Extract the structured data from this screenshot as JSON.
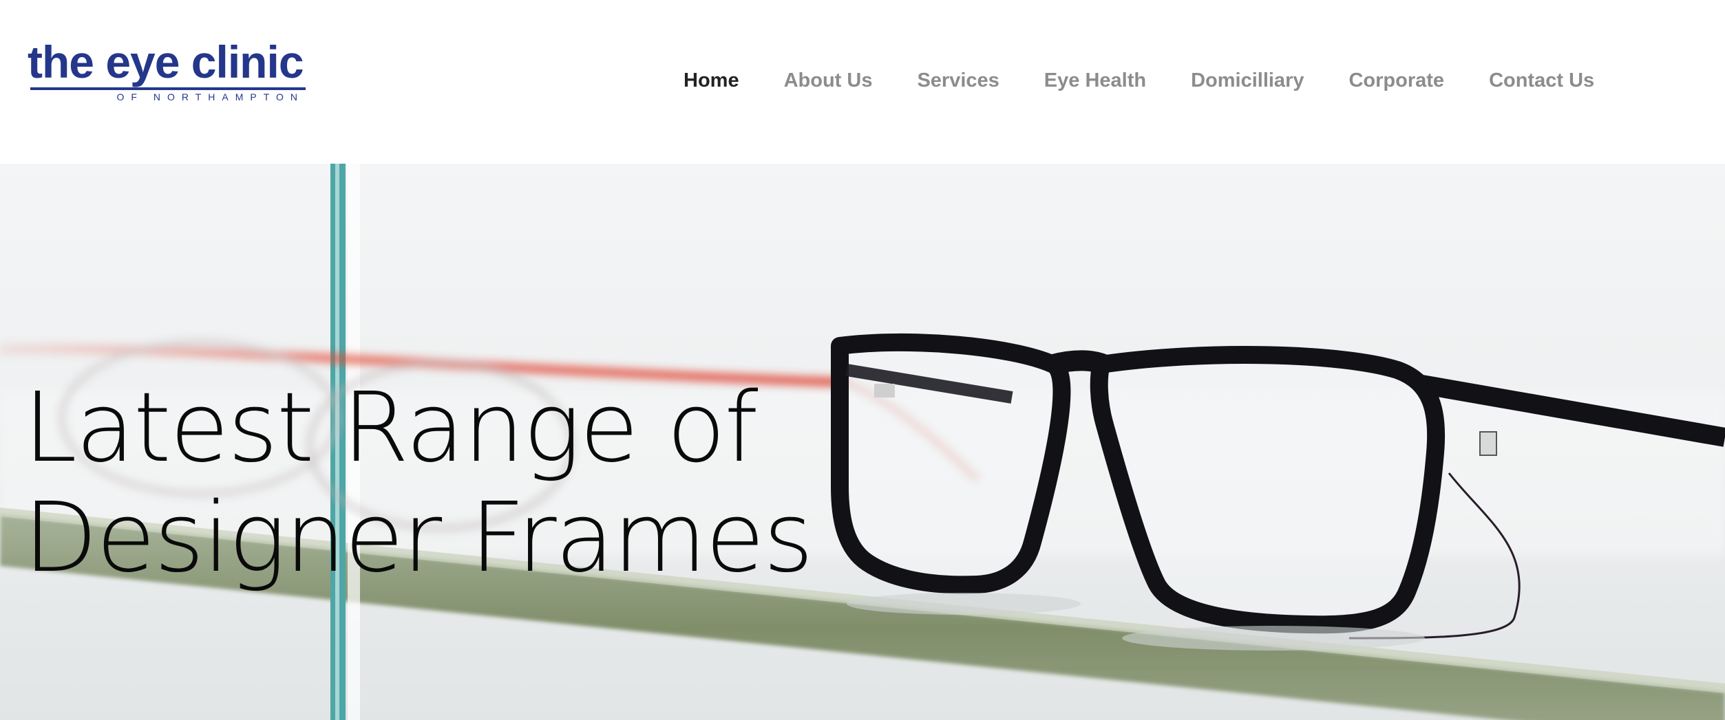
{
  "logo": {
    "title": "the eye clinic",
    "subtitle": "OF NORTHAMPTON",
    "color": "#24378a"
  },
  "nav": {
    "items": [
      {
        "label": "Home",
        "active": true
      },
      {
        "label": "About Us",
        "active": false
      },
      {
        "label": "Services",
        "active": false
      },
      {
        "label": "Eye Health",
        "active": false
      },
      {
        "label": "Domicilliary",
        "active": false
      },
      {
        "label": "Corporate",
        "active": false
      },
      {
        "label": "Contact Us",
        "active": false
      }
    ],
    "active_color": "#222222",
    "inactive_color": "#8c8c8c"
  },
  "hero": {
    "title": "Latest Range of Designer Frames",
    "image": "black-rectangular-eyeglasses-on-glass-shelf"
  }
}
